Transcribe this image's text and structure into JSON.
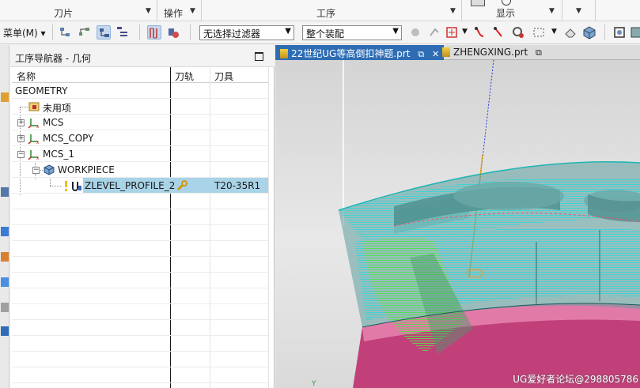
{
  "ribbon": {
    "group_tool": "刀片",
    "group_operate": "操作",
    "group_process": "工序",
    "group_display": "显示"
  },
  "toolbar": {
    "menu_label": "菜单(M)",
    "filter_select": "无选择过滤器",
    "assembly_select": "整个装配"
  },
  "navigator": {
    "title": "工序导航器 - 几何",
    "columns": [
      "名称",
      "刀轨",
      "刀具"
    ],
    "rows": [
      {
        "name": "GEOMETRY",
        "toolpath": "",
        "tool": ""
      },
      {
        "name": "未用项",
        "toolpath": "",
        "tool": ""
      },
      {
        "name": "MCS",
        "toolpath": "",
        "tool": ""
      },
      {
        "name": "MCS_COPY",
        "toolpath": "",
        "tool": ""
      },
      {
        "name": "MCS_1",
        "toolpath": "",
        "tool": ""
      },
      {
        "name": "WORKPIECE",
        "toolpath": "",
        "tool": ""
      },
      {
        "name": "ZLEVEL_PROFILE_2",
        "toolpath": "wrench-icon",
        "tool": "T20-35R1"
      }
    ]
  },
  "tabs": [
    {
      "label": "22世纪UG等高倒扣神题.prt",
      "active": true
    },
    {
      "label": "ZHENGXING.prt",
      "active": false
    }
  ],
  "viewport": {
    "watermark": "UG爱好者论坛@298805786"
  },
  "colors": {
    "tab_active": "#2e6db4",
    "selected_row": "#a9d3e6",
    "toolpath_cyan": "#35d6d6",
    "toolpath_green": "#55e04a",
    "part_pink": "#c2407a"
  }
}
